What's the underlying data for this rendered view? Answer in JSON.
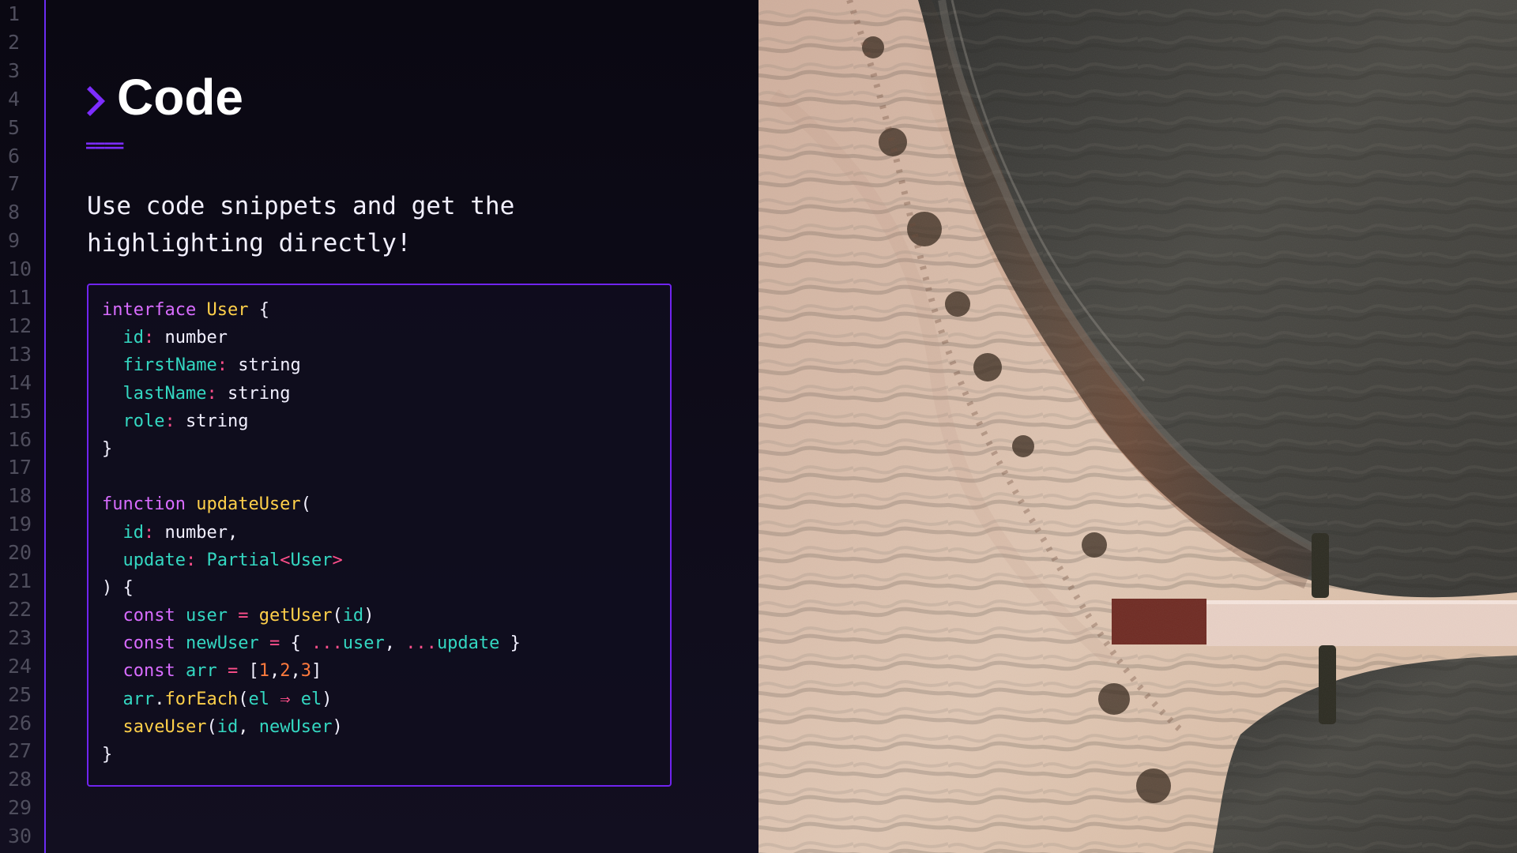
{
  "editor": {
    "line_numbers": [
      "1",
      "2",
      "3",
      "4",
      "5",
      "6",
      "7",
      "8",
      "9",
      "10",
      "11",
      "12",
      "13",
      "14",
      "15",
      "16",
      "17",
      "18",
      "19",
      "20",
      "21",
      "22",
      "23",
      "24",
      "25",
      "26",
      "27",
      "28",
      "29",
      "30"
    ],
    "icon": "chevron-right-icon",
    "title": "Code",
    "underline": "====",
    "description": "Use code snippets and get the highlighting directly!",
    "code_lines": [
      [
        {
          "text": "interface",
          "kind": "keyword"
        },
        {
          "text": " ",
          "kind": "plain"
        },
        {
          "text": "User",
          "kind": "type"
        },
        {
          "text": " {",
          "kind": "plain"
        }
      ],
      [
        {
          "text": "  ",
          "kind": "plain"
        },
        {
          "text": "id",
          "kind": "prop"
        },
        {
          "text": ":",
          "kind": "colon"
        },
        {
          "text": " number",
          "kind": "plain"
        }
      ],
      [
        {
          "text": "  ",
          "kind": "plain"
        },
        {
          "text": "firstName",
          "kind": "prop"
        },
        {
          "text": ":",
          "kind": "colon"
        },
        {
          "text": " string",
          "kind": "plain"
        }
      ],
      [
        {
          "text": "  ",
          "kind": "plain"
        },
        {
          "text": "lastName",
          "kind": "prop"
        },
        {
          "text": ":",
          "kind": "colon"
        },
        {
          "text": " string",
          "kind": "plain"
        }
      ],
      [
        {
          "text": "  ",
          "kind": "plain"
        },
        {
          "text": "role",
          "kind": "prop"
        },
        {
          "text": ":",
          "kind": "colon"
        },
        {
          "text": " string",
          "kind": "plain"
        }
      ],
      [
        {
          "text": "}",
          "kind": "plain"
        }
      ],
      [],
      [
        {
          "text": "function",
          "kind": "keyword"
        },
        {
          "text": " ",
          "kind": "plain"
        },
        {
          "text": "updateUser",
          "kind": "func"
        },
        {
          "text": "(",
          "kind": "plain"
        }
      ],
      [
        {
          "text": "  ",
          "kind": "plain"
        },
        {
          "text": "id",
          "kind": "prop"
        },
        {
          "text": ":",
          "kind": "colon"
        },
        {
          "text": " number,",
          "kind": "plain"
        }
      ],
      [
        {
          "text": "  ",
          "kind": "plain"
        },
        {
          "text": "update",
          "kind": "prop"
        },
        {
          "text": ":",
          "kind": "colon"
        },
        {
          "text": " ",
          "kind": "plain"
        },
        {
          "text": "Partial",
          "kind": "generic"
        },
        {
          "text": "<",
          "kind": "operator"
        },
        {
          "text": "User",
          "kind": "generic"
        },
        {
          "text": ">",
          "kind": "operator"
        }
      ],
      [
        {
          "text": ") {",
          "kind": "plain"
        }
      ],
      [
        {
          "text": "  ",
          "kind": "plain"
        },
        {
          "text": "const",
          "kind": "keyword"
        },
        {
          "text": " ",
          "kind": "plain"
        },
        {
          "text": "user",
          "kind": "prop"
        },
        {
          "text": " ",
          "kind": "plain"
        },
        {
          "text": "=",
          "kind": "operator"
        },
        {
          "text": " ",
          "kind": "plain"
        },
        {
          "text": "getUser",
          "kind": "func"
        },
        {
          "text": "(",
          "kind": "plain"
        },
        {
          "text": "id",
          "kind": "prop"
        },
        {
          "text": ")",
          "kind": "plain"
        }
      ],
      [
        {
          "text": "  ",
          "kind": "plain"
        },
        {
          "text": "const",
          "kind": "keyword"
        },
        {
          "text": " ",
          "kind": "plain"
        },
        {
          "text": "newUser",
          "kind": "prop"
        },
        {
          "text": " ",
          "kind": "plain"
        },
        {
          "text": "=",
          "kind": "operator"
        },
        {
          "text": " { ",
          "kind": "plain"
        },
        {
          "text": "...",
          "kind": "operator"
        },
        {
          "text": "user",
          "kind": "prop"
        },
        {
          "text": ", ",
          "kind": "plain"
        },
        {
          "text": "...",
          "kind": "operator"
        },
        {
          "text": "update",
          "kind": "prop"
        },
        {
          "text": " }",
          "kind": "plain"
        }
      ],
      [
        {
          "text": "  ",
          "kind": "plain"
        },
        {
          "text": "const",
          "kind": "keyword"
        },
        {
          "text": " ",
          "kind": "plain"
        },
        {
          "text": "arr",
          "kind": "prop"
        },
        {
          "text": " ",
          "kind": "plain"
        },
        {
          "text": "=",
          "kind": "operator"
        },
        {
          "text": " [",
          "kind": "plain"
        },
        {
          "text": "1",
          "kind": "number"
        },
        {
          "text": ",",
          "kind": "plain"
        },
        {
          "text": "2",
          "kind": "number"
        },
        {
          "text": ",",
          "kind": "plain"
        },
        {
          "text": "3",
          "kind": "number"
        },
        {
          "text": "]",
          "kind": "plain"
        }
      ],
      [
        {
          "text": "  ",
          "kind": "plain"
        },
        {
          "text": "arr",
          "kind": "prop"
        },
        {
          "text": ".",
          "kind": "plain"
        },
        {
          "text": "forEach",
          "kind": "func"
        },
        {
          "text": "(",
          "kind": "plain"
        },
        {
          "text": "el",
          "kind": "prop"
        },
        {
          "text": " ",
          "kind": "plain"
        },
        {
          "text": "⇒",
          "kind": "operator"
        },
        {
          "text": " ",
          "kind": "plain"
        },
        {
          "text": "el",
          "kind": "prop"
        },
        {
          "text": ")",
          "kind": "plain"
        }
      ],
      [
        {
          "text": "  ",
          "kind": "plain"
        },
        {
          "text": "saveUser",
          "kind": "func"
        },
        {
          "text": "(",
          "kind": "plain"
        },
        {
          "text": "id",
          "kind": "prop"
        },
        {
          "text": ", ",
          "kind": "plain"
        },
        {
          "text": "newUser",
          "kind": "prop"
        },
        {
          "text": ")",
          "kind": "plain"
        }
      ],
      [
        {
          "text": "}",
          "kind": "plain"
        }
      ]
    ]
  },
  "theme": {
    "accent": "#7024ef",
    "background": "#0d0b16",
    "text": "#f2f0ff",
    "keyword": "#d86cff",
    "type": "#ffd04a",
    "property": "#34d8c2",
    "operator": "#ff4f8b",
    "number": "#ff7a3d"
  },
  "photo": {
    "icon": "beach-aerial-photo"
  }
}
